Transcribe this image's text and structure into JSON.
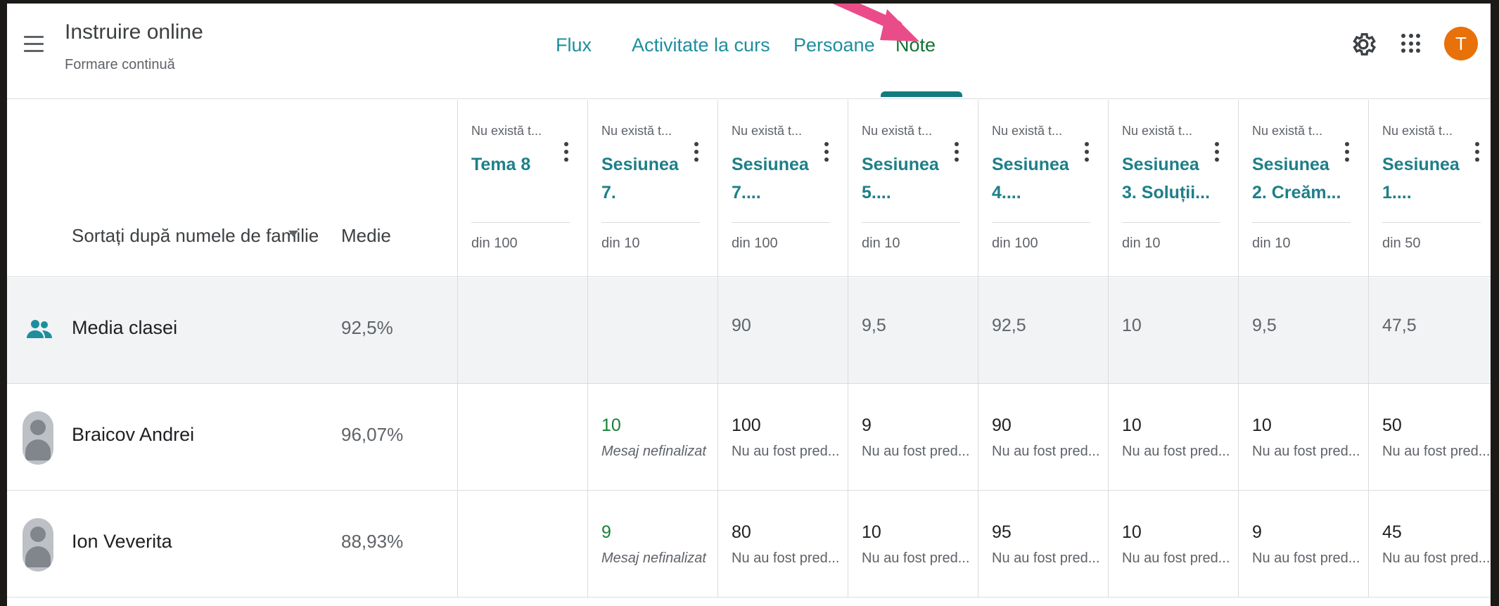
{
  "header": {
    "class_title": "Instruire online",
    "class_subtitle": "Formare continuă",
    "tabs": [
      "Flux",
      "Activitate la curs",
      "Persoane",
      "Note"
    ],
    "active_tab": "Note",
    "avatar_letter": "T",
    "icons": [
      "menu-icon",
      "settings-gear-icon",
      "google-apps-icon"
    ]
  },
  "grid": {
    "sort_label": "Sortați după numele de familie",
    "medie_label": "Medie",
    "columns": [
      {
        "due": "Nu există t...",
        "title_lines": [
          "Tema 8"
        ],
        "points": "din 100"
      },
      {
        "due": "Nu există t...",
        "title_lines": [
          "Sesiunea",
          "7."
        ],
        "points": "din 10"
      },
      {
        "due": "Nu există t...",
        "title_lines": [
          "Sesiunea",
          "7...."
        ],
        "points": "din 100"
      },
      {
        "due": "Nu există t...",
        "title_lines": [
          "Sesiunea",
          "5...."
        ],
        "points": "din 10"
      },
      {
        "due": "Nu există t...",
        "title_lines": [
          "Sesiunea",
          "4...."
        ],
        "points": "din 100"
      },
      {
        "due": "Nu există t...",
        "title_lines": [
          "Sesiunea",
          "3. Soluții..."
        ],
        "points": "din 10"
      },
      {
        "due": "Nu există t...",
        "title_lines": [
          "Sesiunea",
          "2. Creăm..."
        ],
        "points": "din 10"
      },
      {
        "due": "Nu există t...",
        "title_lines": [
          "Sesiunea",
          "1...."
        ],
        "points": "din 50"
      }
    ],
    "class_average": {
      "name": "Media clasei",
      "medie": "92,5%",
      "values": [
        "",
        "",
        "90",
        "9,5",
        "92,5",
        "10",
        "9,5",
        "47,5"
      ]
    },
    "students": [
      {
        "name": "Braicov Andrei",
        "medie": "96,07%",
        "cells": [
          {
            "value": "",
            "status": ""
          },
          {
            "value": "10",
            "status": "Mesaj nefinalizat"
          },
          {
            "value": "100",
            "status": "Nu au fost pred..."
          },
          {
            "value": "9",
            "status": "Nu au fost pred..."
          },
          {
            "value": "90",
            "status": "Nu au fost pred..."
          },
          {
            "value": "10",
            "status": "Nu au fost pred..."
          },
          {
            "value": "10",
            "status": "Nu au fost pred..."
          },
          {
            "value": "50",
            "status": "Nu au fost pred..."
          }
        ]
      },
      {
        "name": "Ion Veverita",
        "medie": "88,93%",
        "cells": [
          {
            "value": "",
            "status": ""
          },
          {
            "value": "9",
            "status": "Mesaj nefinalizat"
          },
          {
            "value": "80",
            "status": "Nu au fost pred..."
          },
          {
            "value": "10",
            "status": "Nu au fost pred..."
          },
          {
            "value": "95",
            "status": "Nu au fost pred..."
          },
          {
            "value": "10",
            "status": "Nu au fost pred..."
          },
          {
            "value": "9",
            "status": "Nu au fost pred..."
          },
          {
            "value": "45",
            "status": "Nu au fost pred..."
          }
        ]
      }
    ]
  },
  "colors": {
    "tab_link": "#1e8e9e",
    "tab_active": "#137333",
    "assignment_title": "#1e7f88",
    "draft_grade": "#188038",
    "avatar_bg": "#e8710a",
    "arrow": "#ea4c89"
  }
}
